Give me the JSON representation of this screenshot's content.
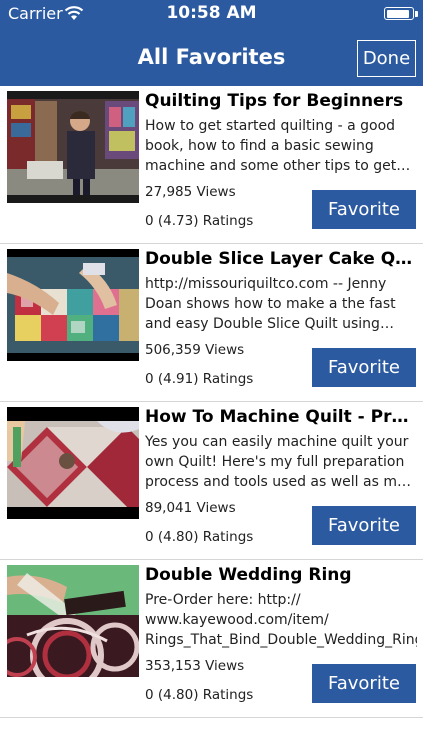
{
  "status_bar": {
    "carrier": "Carrier",
    "time": "10:58 AM",
    "wifi_icon": "wifi-icon",
    "battery_icon": "battery-icon",
    "battery_level": 0.9
  },
  "nav": {
    "title": "All Favorites",
    "done_label": "Done"
  },
  "colors": {
    "nav_background": "#2c5aa0",
    "button_background": "#2c5aa0",
    "separator": "#d6d6d6"
  },
  "videos": [
    {
      "title": "Quilting Tips for Beginners",
      "description": "How to get started quilting - a good book, how to find a basic sewing machine and some other tips to get you started sewing...",
      "views": "27,985 Views",
      "ratings": "0 (4.73) Ratings",
      "button_label": "Favorite"
    },
    {
      "title": "Double Slice Layer Cake Quilt Tutorial",
      "description": "http://missouriquiltco.com -- Jenny Doan shows how to make a the fast and easy Double Slice Quilt using Layer Cakes....",
      "views": "506,359 Views",
      "ratings": "0 (4.91) Ratings",
      "button_label": "Favorite"
    },
    {
      "title": "How To Machine Quilt - Prep, Tools...",
      "description": "Yes you can easily machine quilt your own Quilt! Here's my full preparation process and tools used as well as my tips for pinning yo...",
      "views": "89,041 Views",
      "ratings": "0 (4.80) Ratings",
      "button_label": "Favorite"
    },
    {
      "title": "Double Wedding Ring",
      "description": "Pre-Order here: http:// www.kayewood.com/item/ Rings_That_Bind_Double_Wedding_Ring_Bo...",
      "views": "353,153 Views",
      "ratings": "0 (4.80) Ratings",
      "button_label": "Favorite"
    }
  ]
}
